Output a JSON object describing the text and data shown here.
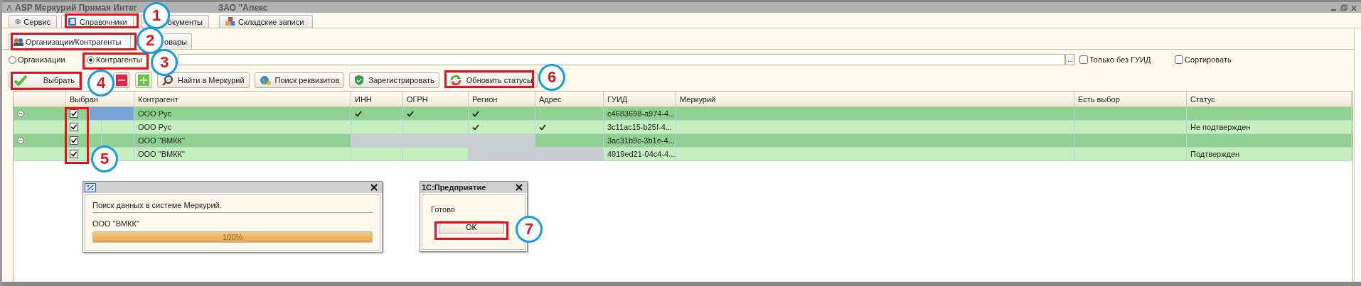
{
  "window": {
    "title_parts": [
      "ASP Меркурий Прямая Интег",
      "ЗАО \"Алекс"
    ]
  },
  "tabs": [
    {
      "label": "Сервис",
      "selected": false
    },
    {
      "label": "Справочники",
      "selected": true
    },
    {
      "label": "окументы",
      "selected": false
    },
    {
      "label": "Складские записи",
      "selected": false
    }
  ],
  "subtabs": [
    {
      "label": "Организации/Контрагенты",
      "selected": true
    },
    {
      "label": "овары",
      "selected": false
    }
  ],
  "filter": {
    "radios": [
      {
        "label": "Организации",
        "selected": false
      },
      {
        "label": "Контрагенты",
        "selected": true
      }
    ],
    "select_button": "...",
    "checkboxes": [
      {
        "label": "Только без ГУИД",
        "checked": false
      },
      {
        "label": "Сортировать",
        "checked": false
      }
    ]
  },
  "toolbar": [
    {
      "kind": "text",
      "label": "Выбрать"
    },
    {
      "kind": "remove"
    },
    {
      "kind": "add"
    },
    {
      "kind": "text",
      "label": "Найти в Меркурий"
    },
    {
      "kind": "text",
      "label": "Поиск реквизитов"
    },
    {
      "kind": "text",
      "label": "Зарегистрировать"
    },
    {
      "kind": "text",
      "label": "Обновить статусы"
    }
  ],
  "table": {
    "columns": [
      "Выбран",
      "Контрагент",
      "ИНН",
      "ОГРН",
      "Регион",
      "Адрес",
      "ГУИД",
      "Меркурий",
      "Есть выбор",
      "Статус"
    ],
    "rows": [
      {
        "kind": "group",
        "chosen": true,
        "current": true,
        "name": "ООО Рус",
        "flags": [
          {
            "checked": true,
            "grey": false
          },
          {
            "checked": true,
            "grey": false
          },
          {
            "checked": true,
            "grey": false
          },
          {
            "checked": false,
            "grey": false
          }
        ],
        "guid": "c4683698-a974-4...",
        "status": ""
      },
      {
        "kind": "item",
        "chosen": true,
        "current": false,
        "name": "ООО Рус",
        "flags": [
          {
            "checked": false,
            "grey": false
          },
          {
            "checked": false,
            "grey": false
          },
          {
            "checked": true,
            "grey": false
          },
          {
            "checked": true,
            "grey": false
          }
        ],
        "guid": "3c11ac15-b25f-4...",
        "status": "Не подтвержден"
      },
      {
        "kind": "group",
        "chosen": true,
        "current": false,
        "name": "ООО \"ВМКК\"",
        "flags": [
          {
            "checked": false,
            "grey": true
          },
          {
            "checked": false,
            "grey": true
          },
          {
            "checked": false,
            "grey": true
          },
          {
            "checked": false,
            "grey": false
          }
        ],
        "guid": "3ac31b9c-3b1e-4...",
        "status": ""
      },
      {
        "kind": "item",
        "chosen": true,
        "current": false,
        "name": "ООО \"ВМКК\"",
        "flags": [
          {
            "checked": false,
            "grey": false
          },
          {
            "checked": false,
            "grey": false
          },
          {
            "checked": false,
            "grey": true
          },
          {
            "checked": false,
            "grey": true
          }
        ],
        "guid": "4919ed21-04c4-4...",
        "status": "Подтвержден"
      }
    ]
  },
  "progress_dialog": {
    "message": "Поиск данных в системе Меркурий.",
    "item": "ООО \"ВМКК\"",
    "level": 1.0,
    "percent": "100%"
  },
  "message_dialog": {
    "title": "1С:Предприятие",
    "message": "Готово",
    "button": "OK"
  },
  "callouts": [
    {
      "number": "1"
    },
    {
      "number": "2"
    },
    {
      "number": "3"
    },
    {
      "number": "4"
    },
    {
      "number": "5"
    },
    {
      "number": "6"
    },
    {
      "number": "7"
    }
  ]
}
